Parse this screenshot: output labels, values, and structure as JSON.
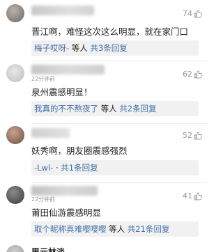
{
  "comments": [
    {
      "likes": "74",
      "text": "晋江啊，难怪这次这么明显，就在家门口",
      "reply": {
        "author": "梅子哎呀-",
        "mid": " 等人 ",
        "count": "共3条回复"
      }
    },
    {
      "likes": "62",
      "time": "22分钟前",
      "text": "泉州震感明显！",
      "reply": {
        "author": "我真的不不熬夜了",
        "mid": " 等人 ",
        "count": "共2条回复"
      }
    },
    {
      "likes": "52",
      "text": "妖秀啊，朋友圈震感强烈",
      "reply": {
        "author": "-Lwl-",
        "mid": " · ",
        "count": "共1条回复"
      }
    },
    {
      "likes": "41",
      "time": "22分钟前",
      "text": "莆田仙游震感明显",
      "reply": {
        "author": "取个昵称真难嘤嘤嘤",
        "mid": " 等人 ",
        "count": "共21条回复"
      }
    },
    {
      "text": "思元林淡"
    }
  ],
  "icons": {
    "like": "thumbs-up-icon"
  }
}
